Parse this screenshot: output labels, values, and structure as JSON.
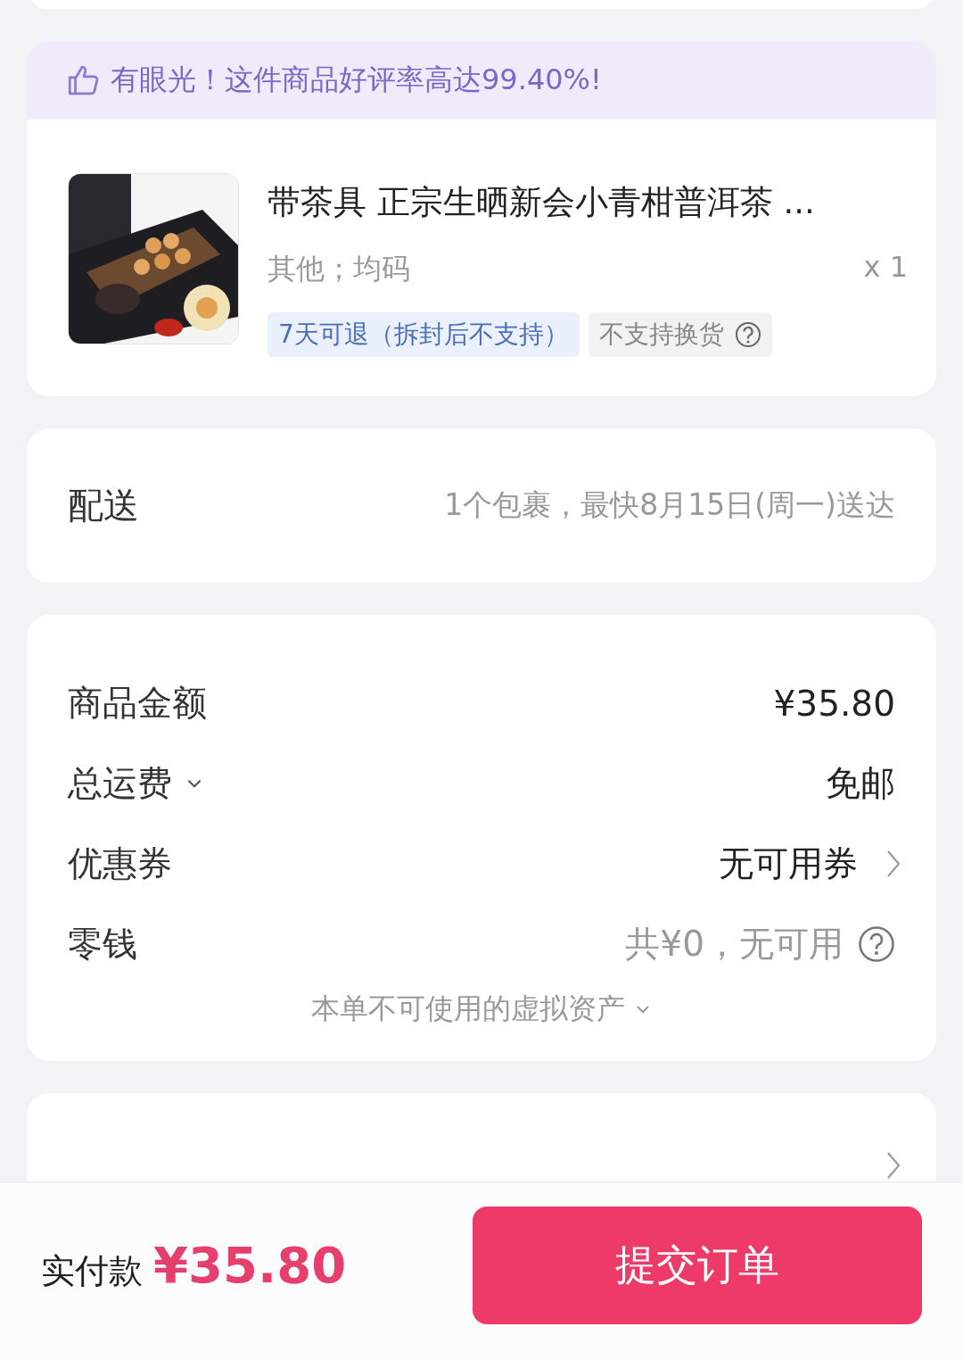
{
  "banner": {
    "text": "有眼光！这件商品好评率高达99.40%!"
  },
  "product": {
    "title": "带茶具 正宗生晒新会小青柑普洱茶 ...",
    "spec": "其他；均码",
    "quantity": "x 1",
    "tags": [
      {
        "text": "7天可退（拆封后不支持）",
        "kind": "info"
      },
      {
        "text": "不支持换货",
        "kind": "help"
      }
    ]
  },
  "delivery": {
    "label": "配送",
    "value": "1个包裹，最快8月15日(周一)送达"
  },
  "price_rows": [
    {
      "label": "商品金额",
      "value": "¥35.80",
      "kind": "plain"
    },
    {
      "label": "总运费",
      "value": "免邮",
      "kind": "dropdown"
    },
    {
      "label": "优惠券",
      "value": "无可用券",
      "kind": "link"
    },
    {
      "label": "零钱",
      "value": "共¥0，无可用",
      "kind": "help"
    }
  ],
  "virtual_assets": "本单不可使用的虚拟资产",
  "footer": {
    "label": "实付款",
    "total": "¥35.80",
    "submit": "提交订单"
  }
}
